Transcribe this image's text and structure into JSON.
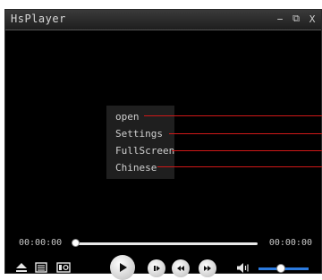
{
  "window": {
    "title": "HsPlayer",
    "controls": {
      "minimize": "−",
      "restore": "⧉",
      "close": "X"
    }
  },
  "context_menu": {
    "items": [
      {
        "label": "open"
      },
      {
        "label": "Settings"
      },
      {
        "label": "FullScreen"
      },
      {
        "label": "Chinese"
      }
    ]
  },
  "playback": {
    "elapsed": "00:00:00",
    "total": "00:00:00",
    "progress": 0
  },
  "volume": {
    "level": 0.45
  },
  "icons": {
    "eject": "eject-icon",
    "playlist": "playlist-icon",
    "snapshot": "snapshot-icon",
    "play": "play-icon",
    "pause": "pause-icon",
    "previous": "rewind-icon",
    "next": "fast-forward-icon",
    "volume": "speaker-icon"
  },
  "colors": {
    "background": "#000000",
    "titlebar": "#2a2a2a",
    "menu_background": "#1f1f1f",
    "pointer_line": "#d01818",
    "volume_accent": "#2c7be0"
  }
}
